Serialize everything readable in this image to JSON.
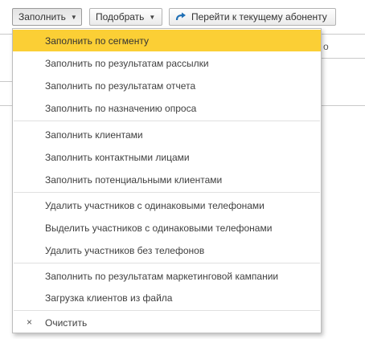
{
  "toolbar": {
    "fill_label": "Заполнить",
    "pick_label": "Подобрать",
    "goto_label": "Перейти к текущему абоненту",
    "accent_color": "#1f6fb5"
  },
  "background": {
    "partial_text": "о"
  },
  "menu": {
    "highlight_color": "#fbcf35",
    "items": [
      {
        "label": "Заполнить по сегменту"
      },
      {
        "label": "Заполнить по результатам рассылки"
      },
      {
        "label": "Заполнить по результатам отчета"
      },
      {
        "label": "Заполнить по назначению опроса"
      },
      {
        "label": "Заполнить клиентами"
      },
      {
        "label": "Заполнить контактными лицами"
      },
      {
        "label": "Заполнить потенциальными клиентами"
      },
      {
        "label": "Удалить участников с одинаковыми телефонами"
      },
      {
        "label": "Выделить участников с одинаковыми телефонами"
      },
      {
        "label": "Удалить участников без телефонов"
      },
      {
        "label": "Заполнить по результатам маркетинговой кампании"
      },
      {
        "label": "Загрузка клиентов из файла"
      },
      {
        "label": "Очистить",
        "icon": "close-icon"
      }
    ]
  }
}
